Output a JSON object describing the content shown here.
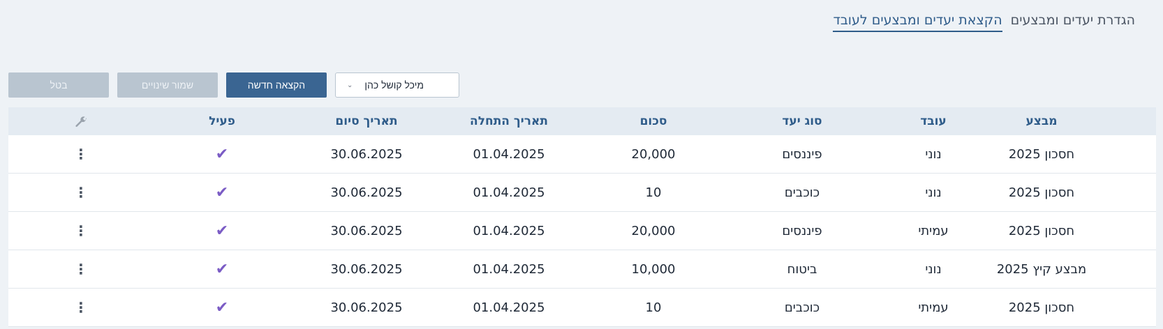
{
  "tabs": [
    {
      "label": "הגדרת יעדים ומבצעים",
      "active": false
    },
    {
      "label": "הקצאת יעדים ומבצעים לעובד",
      "active": true
    }
  ],
  "toolbar": {
    "cancel_label": "בטל",
    "save_label": "שמור שינויים",
    "new_label": "הקצאה חדשה",
    "employee_select_value": "מיכל קושל כהן"
  },
  "table": {
    "headers": {
      "mivtza": "מבצע",
      "oved": "עובד",
      "sug_yaad": "סוג יעד",
      "schum": "סכום",
      "start": "תאריך התחלה",
      "end": "תאריך סיום",
      "active": "פעיל",
      "tools_icon": "wrench-icon"
    },
    "rows": [
      {
        "mivtza": "חסכון 2025",
        "oved": "נוני",
        "sug_yaad": "פיננסים",
        "schum": "20,000",
        "start": "01.04.2025",
        "end": "30.06.2025",
        "active": true
      },
      {
        "mivtza": "חסכון 2025",
        "oved": "נוני",
        "sug_yaad": "כוכבים",
        "schum": "10",
        "start": "01.04.2025",
        "end": "30.06.2025",
        "active": true
      },
      {
        "mivtza": "חסכון 2025",
        "oved": "עמיתי",
        "sug_yaad": "פיננסים",
        "schum": "20,000",
        "start": "01.04.2025",
        "end": "30.06.2025",
        "active": true
      },
      {
        "mivtza": "מבצע קיץ 2025",
        "oved": "נוני",
        "sug_yaad": "ביטוח",
        "schum": "10,000",
        "start": "01.04.2025",
        "end": "30.06.2025",
        "active": true
      },
      {
        "mivtza": "חסכון 2025",
        "oved": "עמיתי",
        "sug_yaad": "כוכבים",
        "schum": "10",
        "start": "01.04.2025",
        "end": "30.06.2025",
        "active": true
      }
    ]
  },
  "colors": {
    "accent": "#3a6592",
    "header_text": "#2f5c8a",
    "check": "#7b5cc5",
    "disabled_button": "#b9c5d0",
    "page_bg": "#eef2f6"
  }
}
